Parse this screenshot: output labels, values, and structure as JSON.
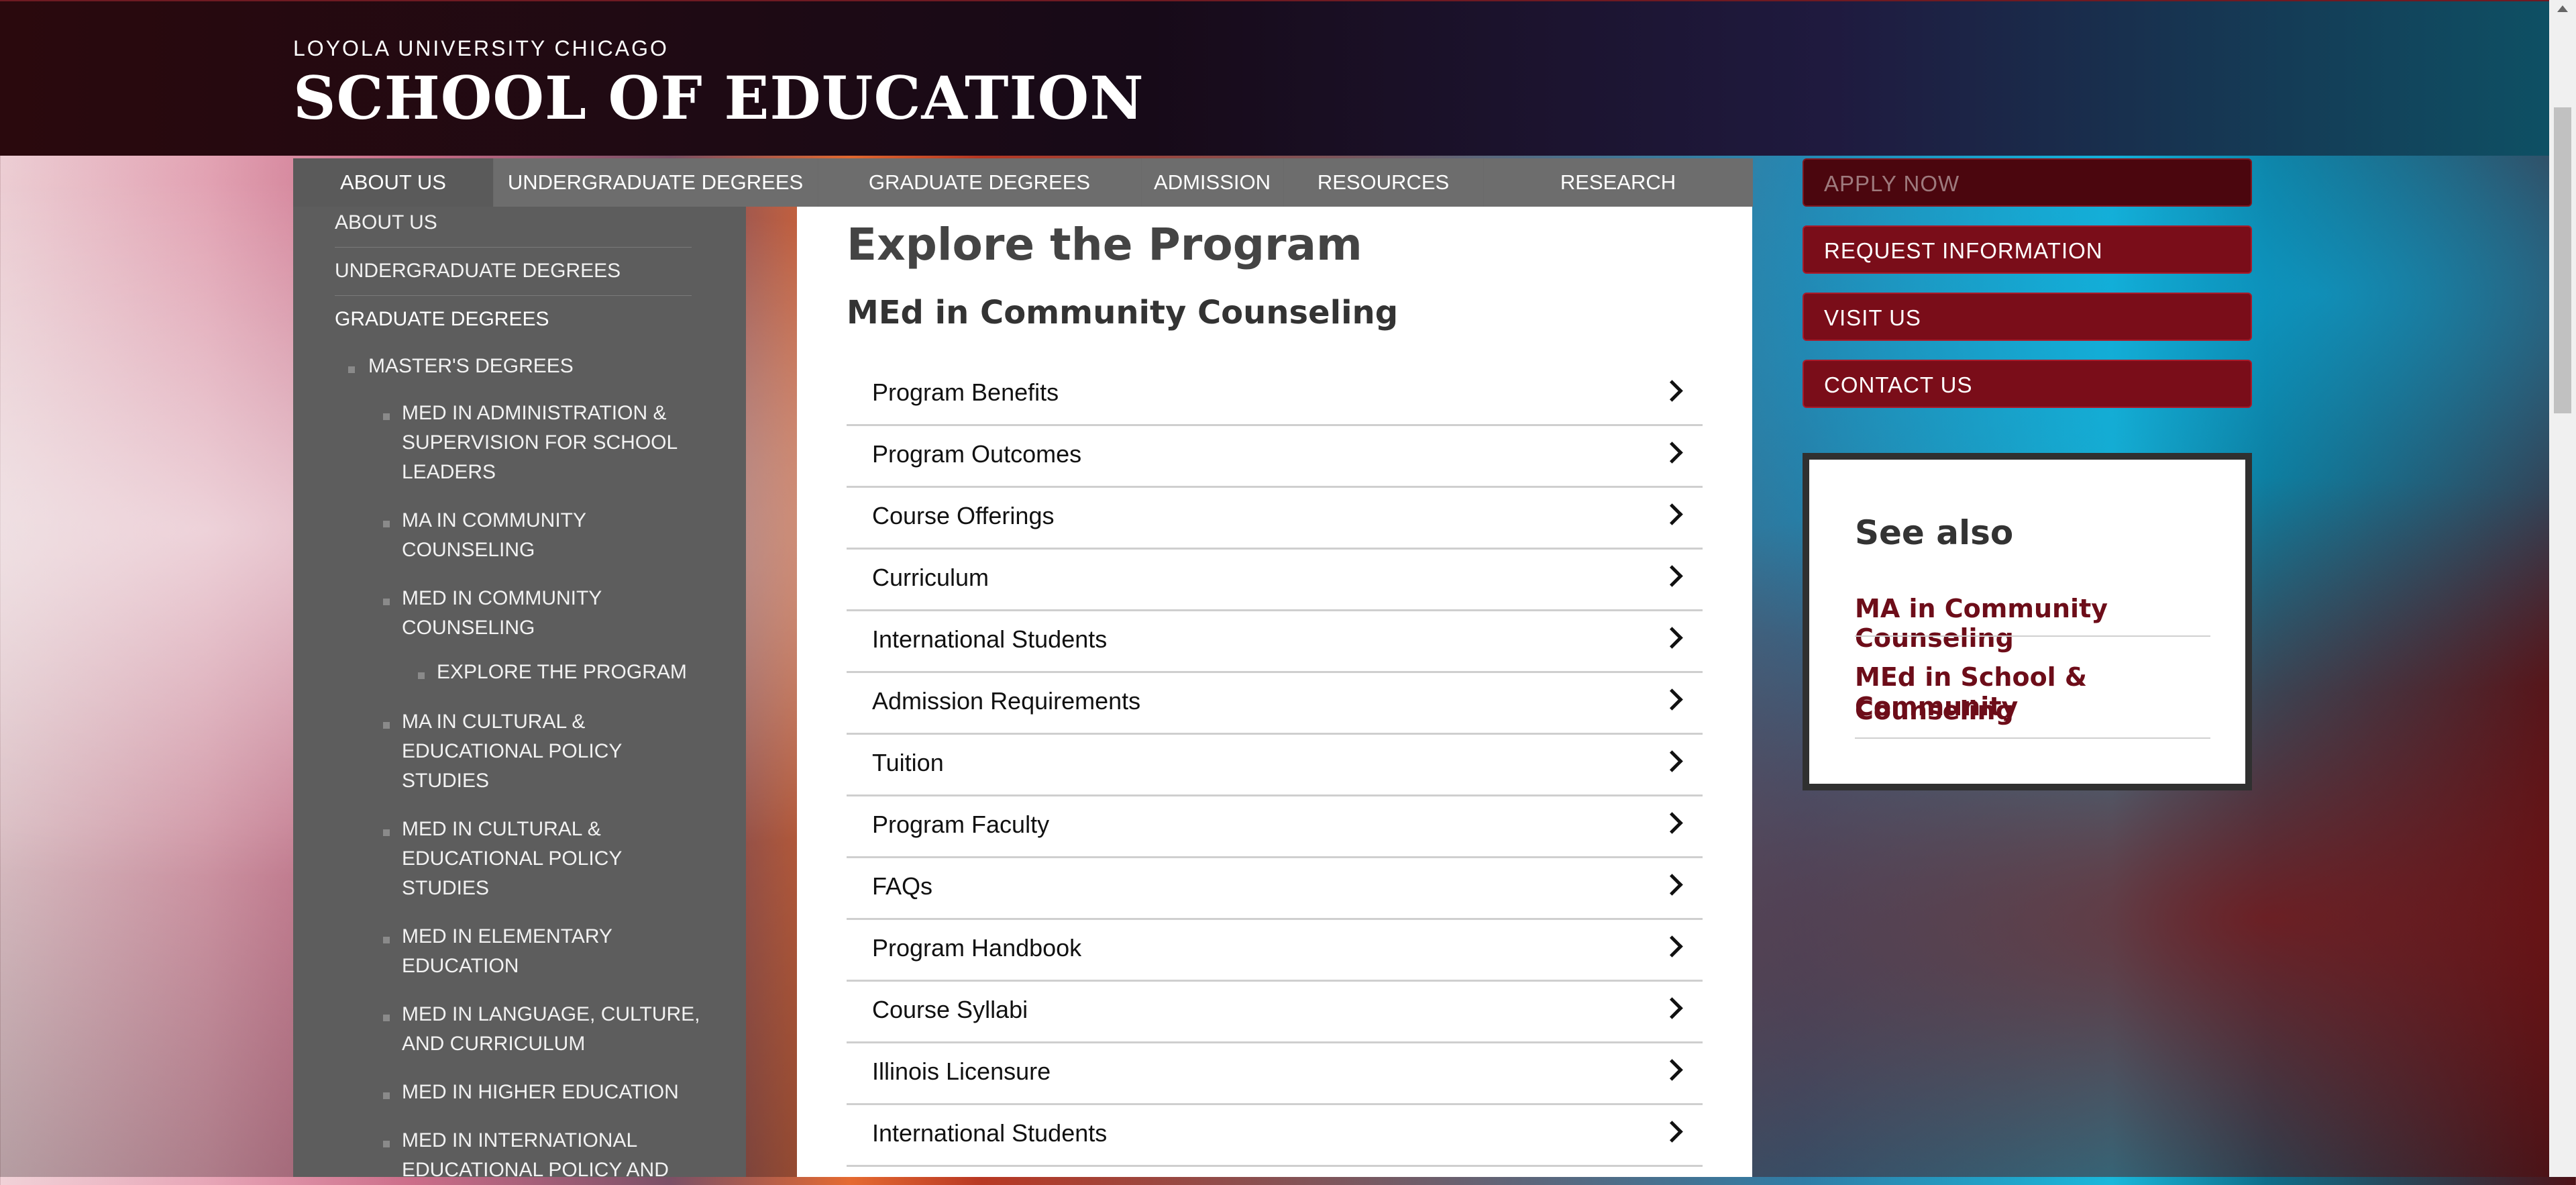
{
  "header": {
    "university": "LOYOLA UNIVERSITY CHICAGO",
    "school": "SCHOOL OF EDUCATION"
  },
  "nav": {
    "items": [
      {
        "label": "ABOUT US"
      },
      {
        "label": "UNDERGRADUATE DEGREES"
      },
      {
        "label": "GRADUATE DEGREES"
      },
      {
        "label": "ADMISSION"
      },
      {
        "label": "RESOURCES"
      },
      {
        "label": "RESEARCH"
      }
    ]
  },
  "actions": {
    "apply_now": "APPLY NOW",
    "request_information": "REQUEST INFORMATION",
    "visit_us": "VISIT US",
    "contact_us": "CONTACT US"
  },
  "sidebar": {
    "about_us": "ABOUT US",
    "undergraduate_degrees": "UNDERGRADUATE DEGREES",
    "graduate_degrees": "GRADUATE DEGREES",
    "masters_degrees": "MASTER'S DEGREES",
    "items": {
      "admin": [
        "MED IN ADMINISTRATION &",
        "SUPERVISION FOR SCHOOL",
        "LEADERS"
      ],
      "ma_counseling": [
        "MA IN COMMUNITY",
        "COUNSELING"
      ],
      "med_counseling": [
        "MED IN COMMUNITY",
        "COUNSELING"
      ],
      "explore": "EXPLORE THE PROGRAM",
      "ma_cultural": [
        "MA IN CULTURAL &",
        "EDUCATIONAL POLICY",
        "STUDIES"
      ],
      "med_cultural": [
        "MED IN CULTURAL &",
        "EDUCATIONAL POLICY",
        "STUDIES"
      ],
      "elementary": [
        "MED IN ELEMENTARY",
        "EDUCATION"
      ],
      "language": [
        "MED IN LANGUAGE, CULTURE,",
        "AND CURRICULUM"
      ],
      "higher": "MED IN HIGHER EDUCATION",
      "international": [
        "MED IN INTERNATIONAL",
        "EDUCATIONAL POLICY AND"
      ]
    }
  },
  "main": {
    "title": "Explore the Program",
    "subtitle": "MEd in Community Counseling",
    "items": [
      "Program Benefits",
      "Program Outcomes",
      "Course Offerings",
      "Curriculum",
      "International Students",
      "Admission Requirements",
      "Tuition",
      "Program Faculty",
      "FAQs",
      "Program Handbook",
      "Course Syllabi",
      "Illinois Licensure",
      "International Students"
    ]
  },
  "see_also": {
    "title": "See also",
    "links": [
      "MA in Community Counseling",
      "MEd in School & Community",
      "Counseling"
    ]
  }
}
